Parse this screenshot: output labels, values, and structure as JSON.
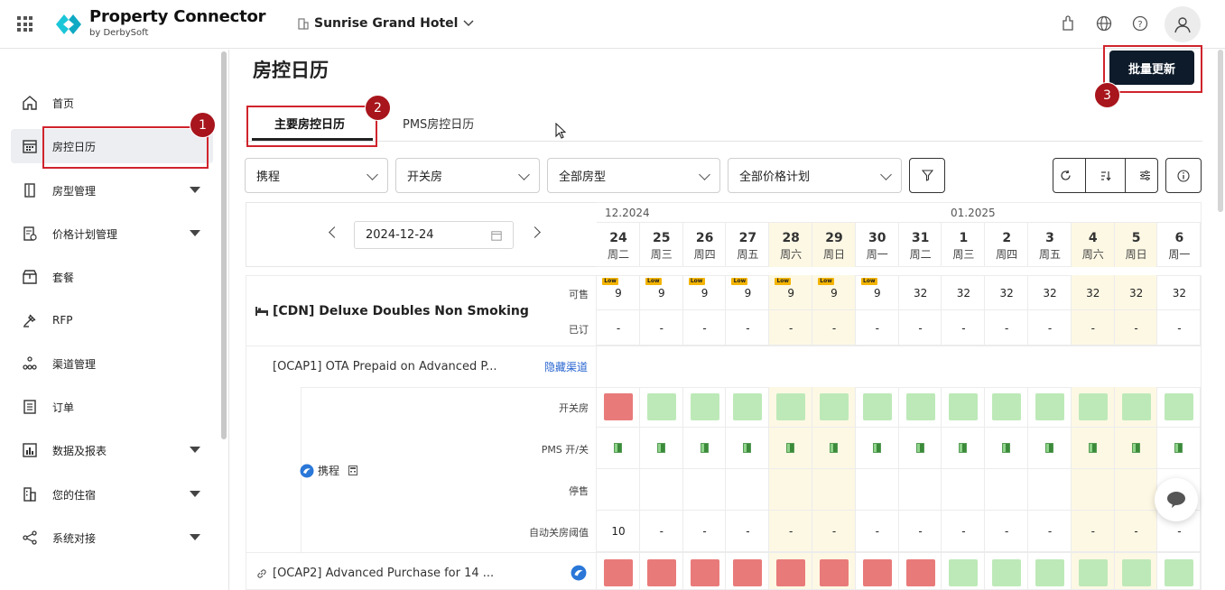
{
  "header": {
    "brand": "Property Connector",
    "brand_sub": "by DerbySoft",
    "hotel": "Sunrise Grand Hotel"
  },
  "sidebar": {
    "items": [
      {
        "label": "首页",
        "icon": "home-icon"
      },
      {
        "label": "房控日历",
        "icon": "calendar-icon",
        "active": true
      },
      {
        "label": "房型管理",
        "icon": "door-icon",
        "expand": true
      },
      {
        "label": "价格计划管理",
        "icon": "rate-plan-icon",
        "expand": true
      },
      {
        "label": "套餐",
        "icon": "package-icon"
      },
      {
        "label": "RFP",
        "icon": "rfp-icon"
      },
      {
        "label": "渠道管理",
        "icon": "channel-icon"
      },
      {
        "label": "订单",
        "icon": "order-icon"
      },
      {
        "label": "数据及报表",
        "icon": "chart-icon",
        "expand": true
      },
      {
        "label": "您的住宿",
        "icon": "building-icon",
        "expand": true
      },
      {
        "label": "系统对接",
        "icon": "share-icon",
        "expand": true
      }
    ]
  },
  "main": {
    "title": "房控日历",
    "bulk_update": "批量更新",
    "tabs": [
      "主要房控日历",
      "PMS房控日历"
    ],
    "filters": [
      "携程",
      "开关房",
      "全部房型",
      "全部价格计划"
    ],
    "date_value": "2024-12-24",
    "months": [
      "12.2024",
      "01.2025"
    ]
  },
  "calendar": {
    "days": [
      {
        "d": "24",
        "w": "周二",
        "weekend": false,
        "avail": "9",
        "low": true,
        "open": "r"
      },
      {
        "d": "25",
        "w": "周三",
        "weekend": false,
        "avail": "9",
        "low": true,
        "open": "g"
      },
      {
        "d": "26",
        "w": "周四",
        "weekend": false,
        "avail": "9",
        "low": true,
        "open": "g"
      },
      {
        "d": "27",
        "w": "周五",
        "weekend": false,
        "avail": "9",
        "low": true,
        "open": "g"
      },
      {
        "d": "28",
        "w": "周六",
        "weekend": true,
        "avail": "9",
        "low": true,
        "open": "g"
      },
      {
        "d": "29",
        "w": "周日",
        "weekend": true,
        "avail": "9",
        "low": true,
        "open": "g"
      },
      {
        "d": "30",
        "w": "周一",
        "weekend": false,
        "avail": "9",
        "low": true,
        "open": "g"
      },
      {
        "d": "31",
        "w": "周二",
        "weekend": false,
        "avail": "32",
        "low": false,
        "open": "g"
      },
      {
        "d": "1",
        "w": "周三",
        "weekend": false,
        "avail": "32",
        "low": false,
        "open": "g"
      },
      {
        "d": "2",
        "w": "周四",
        "weekend": false,
        "avail": "32",
        "low": false,
        "open": "g"
      },
      {
        "d": "3",
        "w": "周五",
        "weekend": false,
        "avail": "32",
        "low": false,
        "open": "g"
      },
      {
        "d": "4",
        "w": "周六",
        "weekend": true,
        "avail": "32",
        "low": false,
        "open": "g"
      },
      {
        "d": "5",
        "w": "周日",
        "weekend": true,
        "avail": "32",
        "low": false,
        "open": "g"
      },
      {
        "d": "6",
        "w": "周一",
        "weekend": false,
        "avail": "32",
        "low": false,
        "open": "g"
      }
    ],
    "ocap2_status": [
      "r",
      "r",
      "r",
      "r",
      "r",
      "r",
      "r",
      "r",
      "g",
      "g",
      "g",
      "g",
      "g",
      "g"
    ],
    "threshold_first": "10",
    "dash": "-",
    "low_label": "Low",
    "room_name": "[CDN] Deluxe Doubles Non Smoking",
    "row_avail": "可售",
    "row_booked": "已订",
    "rate1": "[OCAP1] OTA Prepaid on Advanced P...",
    "hide_channel": "隐藏渠道",
    "row_open": "开关房",
    "row_pms": "PMS 开/关",
    "row_stop": "停售",
    "row_threshold": "自动关房阈值",
    "channel": "携程",
    "rate2": "[OCAP2] Advanced Purchase for 14 ..."
  },
  "annotations": [
    "1",
    "2",
    "3"
  ],
  "colors": {
    "accent": "#0d1b2a",
    "open": "#bde9b8",
    "closed": "#e97a7a",
    "highlight": "#d0242c",
    "weekend": "#fdf8e4"
  }
}
